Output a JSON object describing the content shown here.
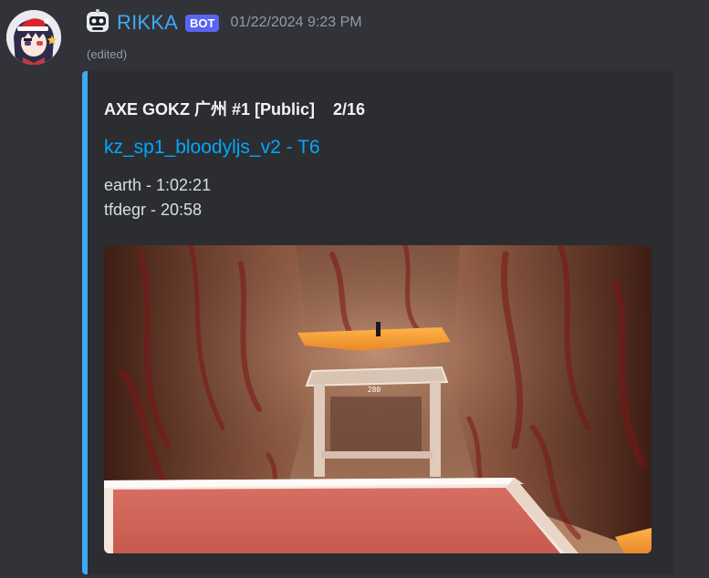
{
  "message": {
    "author": "RIKKA",
    "bot_badge": "BOT",
    "timestamp": "01/22/2024 9:23 PM",
    "edited_label": "(edited)"
  },
  "embed": {
    "accent_color": "#3fa9f5",
    "title": "AXE GOKZ 广州 #1 [Public]    2/16",
    "map_link": "kz_sp1_bloodyljs_v2 - T6",
    "players": [
      "earth - 1:02:21",
      "tfdegr - 20:58"
    ],
    "image_overlay_number": "280"
  },
  "icons": {
    "avatar": "anime-avatar",
    "bot": "robot-icon"
  }
}
